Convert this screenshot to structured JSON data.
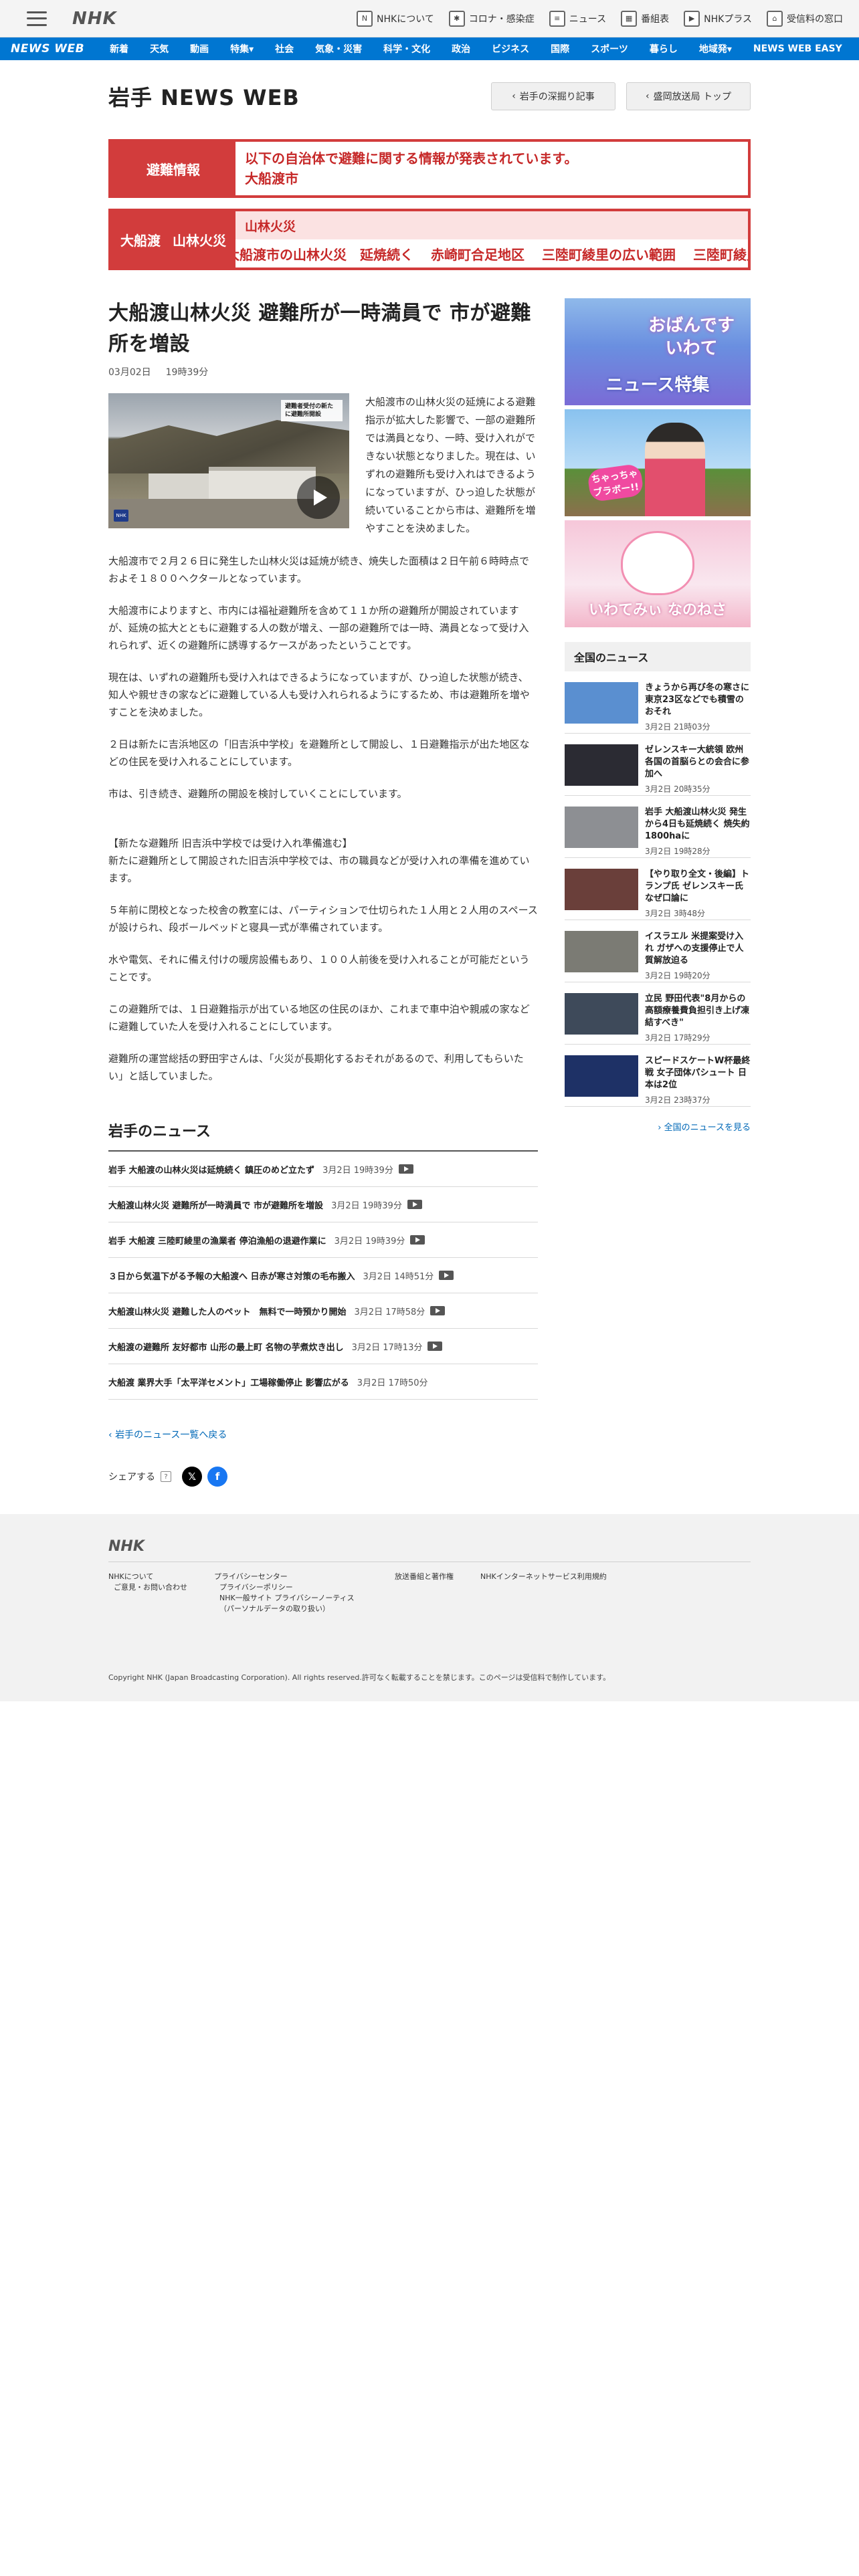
{
  "topbar": {
    "logo": "NHK",
    "links": [
      {
        "label": "NHKについて",
        "icon": "nhk-logo-icon"
      },
      {
        "label": "コロナ・感染症",
        "icon": "virus-icon"
      },
      {
        "label": "ニュース",
        "icon": "news-icon"
      },
      {
        "label": "番組表",
        "icon": "grid-icon"
      },
      {
        "label": "NHKプラス",
        "icon": "play-screen-icon"
      },
      {
        "label": "受信料の窓口",
        "icon": "home-icon"
      }
    ]
  },
  "catnav": {
    "brand": "NEWS WEB",
    "items": [
      "新着",
      "天気",
      "動画",
      "特集▾",
      "社会",
      "気象・災害",
      "科学・文化",
      "政治",
      "ビジネス",
      "国際",
      "スポーツ",
      "暮らし",
      "地域発▾",
      "NEWS WEB EASY"
    ]
  },
  "header": {
    "title": "岩手 NEWS WEB",
    "btn_feature": "岩手の深掘り記事",
    "btn_top": "盛岡放送局 トップ"
  },
  "evac_alert": {
    "label": "避難情報",
    "line1": "以下の自治体で避難に関する情報が発表されています。",
    "line2": "大船渡市"
  },
  "fire_alert": {
    "label_a": "大船渡",
    "label_b": "山林火災",
    "tag": "山林火災",
    "links": [
      "大船渡市の山林火災　延焼続く",
      "赤崎町合足地区",
      "三陸町綾里の広い範囲",
      "三陸町綾里では北東"
    ]
  },
  "article": {
    "title": "大船渡山林火災 避難所が一時満員で 市が避難所を増設",
    "date": "03月02日",
    "time": "19時39分",
    "video_caption": "避難者受付の新たに避難所開設",
    "lead": "大船渡市の山林火災の延焼による避難指示が拡大した影響で、一部の避難所では満員となり、一時、受け入れができない状態となりました。現在は、いずれの避難所も受け入れはできるようになっていますが、ひっ迫した状態が続いていることから市は、避難所を増やすことを決めました。",
    "paragraphs": [
      "大船渡市で２月２６日に発生した山林火災は延焼が続き、焼失した面積は２日午前６時時点でおよそ１８００ヘクタールとなっています。",
      "大船渡市によりますと、市内には福祉避難所を含めて１１か所の避難所が開設されていますが、延焼の拡大とともに避難する人の数が増え、一部の避難所では一時、満員となって受け入れられず、近くの避難所に誘導するケースがあったということです。",
      "現在は、いずれの避難所も受け入れはできるようになっていますが、ひっ迫した状態が続き、知人や親せきの家などに避難している人も受け入れられるようにするため、市は避難所を増やすことを決めました。",
      "２日は新たに吉浜地区の「旧吉浜中学校」を避難所として開設し、１日避難指示が出た地区などの住民を受け入れることにしています。",
      "市は、引き続き、避難所の開設を検討していくことにしています。",
      "【新たな避難所 旧吉浜中学校では受け入れ準備進む】\n新たに避難所として開設された旧吉浜中学校では、市の職員などが受け入れの準備を進めています。",
      "５年前に閉校となった校舎の教室には、パーティションで仕切られた１人用と２人用のスペースが設けられ、段ボールベッドと寝具一式が準備されています。",
      "水や電気、それに備え付けの暖房設備もあり、１００人前後を受け入れることが可能だということです。",
      "この避難所では、１日避難指示が出ている地区の住民のほか、これまで車中泊や親戚の家などに避難していた人を受け入れることにしています。",
      "避難所の運営総括の野田宇さんは、「火災が長期化するおそれがあるので、利用してもらいたい」と話していました。"
    ]
  },
  "local_news": {
    "title": "岩手のニュース",
    "items": [
      {
        "title": "岩手 大船渡の山林火災は延焼続く 鎮圧のめど立たず",
        "date": "3月2日 19時39分",
        "video": true
      },
      {
        "title": "大船渡山林火災 避難所が一時満員で 市が避難所を増設",
        "date": "3月2日 19時39分",
        "video": true
      },
      {
        "title": "岩手 大船渡 三陸町綾里の漁業者 停泊漁船の退避作業に",
        "date": "3月2日 19時39分",
        "video": true
      },
      {
        "title": "３日から気温下がる予報の大船渡へ 日赤が寒さ対策の毛布搬入",
        "date": "3月2日 14時51分",
        "video": true
      },
      {
        "title": "大船渡山林火災 避難した人のペット　無料で一時預かり開始",
        "date": "3月2日 17時58分",
        "video": true
      },
      {
        "title": "大船渡の避難所 友好都市 山形の最上町 名物の芋煮炊き出し",
        "date": "3月2日 17時13分",
        "video": true
      },
      {
        "title": "大船渡 業界大手「太平洋セメント」工場稼働停止 影響広がる",
        "date": "3月2日 17時50分",
        "video": false
      }
    ],
    "back_link": "岩手のニュース一覧へ戻る",
    "share_label": "シェアする",
    "share_help": "?"
  },
  "side": {
    "banner1_line1": "おばんです\nいわて",
    "banner1_line2": "ニュース特集",
    "banner2_badge": "ちゃっちゃ\nブラボー!!",
    "banner3_text": "いわてみぃ なのねさ",
    "national_title": "全国のニュース",
    "national": [
      {
        "title": "きょうから再び冬の寒さに 東京23区などでも積雪のおそれ",
        "date": "3月2日 21時03分",
        "thumb": "#5a8fd0"
      },
      {
        "title": "ゼレンスキー大統領 欧州各国の首脳らとの会合に参加へ",
        "date": "3月2日 20時35分",
        "thumb": "#2b2b33"
      },
      {
        "title": "岩手 大船渡山林火災 発生から4日も延焼続く 焼失約1800haに",
        "date": "3月2日 19時28分",
        "thumb": "#8d8f93"
      },
      {
        "title": "【やり取り全文・後編】トランプ氏 ゼレンスキー氏 なぜ口論に",
        "date": "3月2日 3時48分",
        "thumb": "#6a3f3a"
      },
      {
        "title": "イスラエル 米提案受け入れ ガザへの支援停止で人質解放迫る",
        "date": "3月2日 19時20分",
        "thumb": "#7b7b74"
      },
      {
        "title": "立民 野田代表\"8月からの高額療養費負担引き上げ凍結すべき\"",
        "date": "3月2日 17時29分",
        "thumb": "#3e4a5a"
      },
      {
        "title": "スピードスケートW杯最終戦 女子団体パシュート 日本は2位",
        "date": "3月2日 23時37分",
        "thumb": "#1e3166"
      }
    ],
    "all_link": "全国のニュースを見る"
  },
  "footer": {
    "logo": "NHK",
    "cols": [
      [
        "NHKについて",
        "ご意見・お問い合わせ"
      ],
      [
        "プライバシーセンター",
        "プライバシーポリシー",
        "NHK一般サイト プライバシーノーティス（パーソナルデータの取り扱い）"
      ],
      [
        "放送番組と著作権"
      ],
      [
        "NHKインターネットサービス利用規約"
      ]
    ],
    "copyright": "Copyright NHK (Japan Broadcasting Corporation). All rights reserved.許可なく転載することを禁じます。このページは受信料で制作しています。"
  }
}
